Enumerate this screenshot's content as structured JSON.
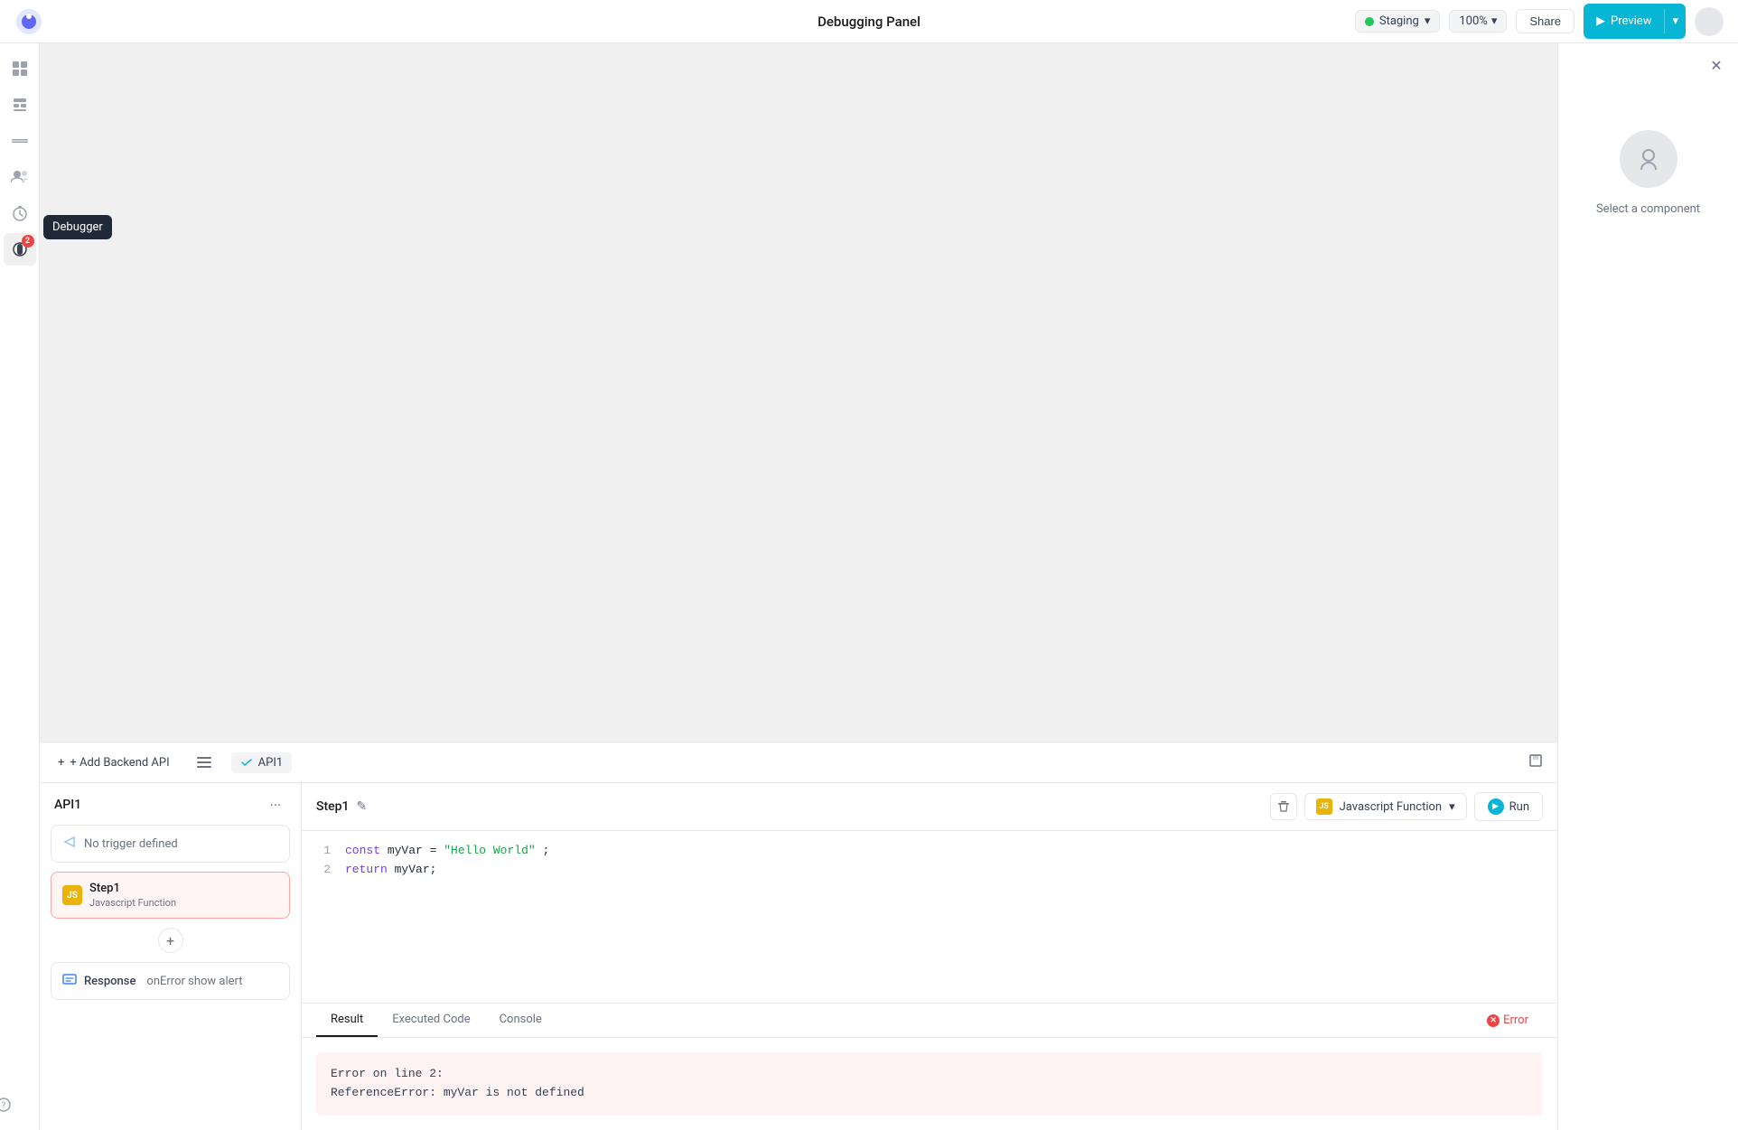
{
  "topbar": {
    "title": "Debugging Panel",
    "status": "Staging",
    "zoom": "100%",
    "share_label": "Share",
    "preview_label": "Preview"
  },
  "sidebar": {
    "items": [
      {
        "id": "grid",
        "icon": "⊞",
        "label": "Grid"
      },
      {
        "id": "apps",
        "icon": "⊟",
        "label": "Apps"
      },
      {
        "id": "menu",
        "icon": "☰",
        "label": "Menu"
      },
      {
        "id": "users",
        "icon": "👥",
        "label": "Users"
      },
      {
        "id": "timer",
        "icon": "⏱",
        "label": "Timer"
      },
      {
        "id": "debugger",
        "icon": "🐛",
        "label": "Debugger",
        "badge": "2",
        "active": true
      }
    ],
    "tooltip": "Debugger",
    "help_icon": "?"
  },
  "bottom_toolbar": {
    "add_api_label": "+ Add Backend API",
    "current_api": "API1"
  },
  "api_panel": {
    "name": "API1",
    "trigger": {
      "label": "No trigger defined"
    },
    "step": {
      "name": "Step1",
      "type": "Javascript Function",
      "badge": "JS"
    },
    "response": {
      "label": "Response",
      "sub": "onError show alert"
    }
  },
  "code_panel": {
    "step_name": "Step1",
    "function_type": "Javascript Function",
    "run_label": "Run",
    "code_lines": [
      {
        "num": "1",
        "content": "const myVar = \"Hello World\";"
      },
      {
        "num": "2",
        "content": "return myVar;"
      }
    ]
  },
  "results": {
    "tabs": [
      {
        "id": "result",
        "label": "Result",
        "active": true
      },
      {
        "id": "executed",
        "label": "Executed Code"
      },
      {
        "id": "console",
        "label": "Console"
      }
    ],
    "status": "Error",
    "error_lines": [
      "Error on line 2:",
      "ReferenceError: myVar is not defined"
    ]
  },
  "right_panel": {
    "select_label": "Select a component"
  }
}
